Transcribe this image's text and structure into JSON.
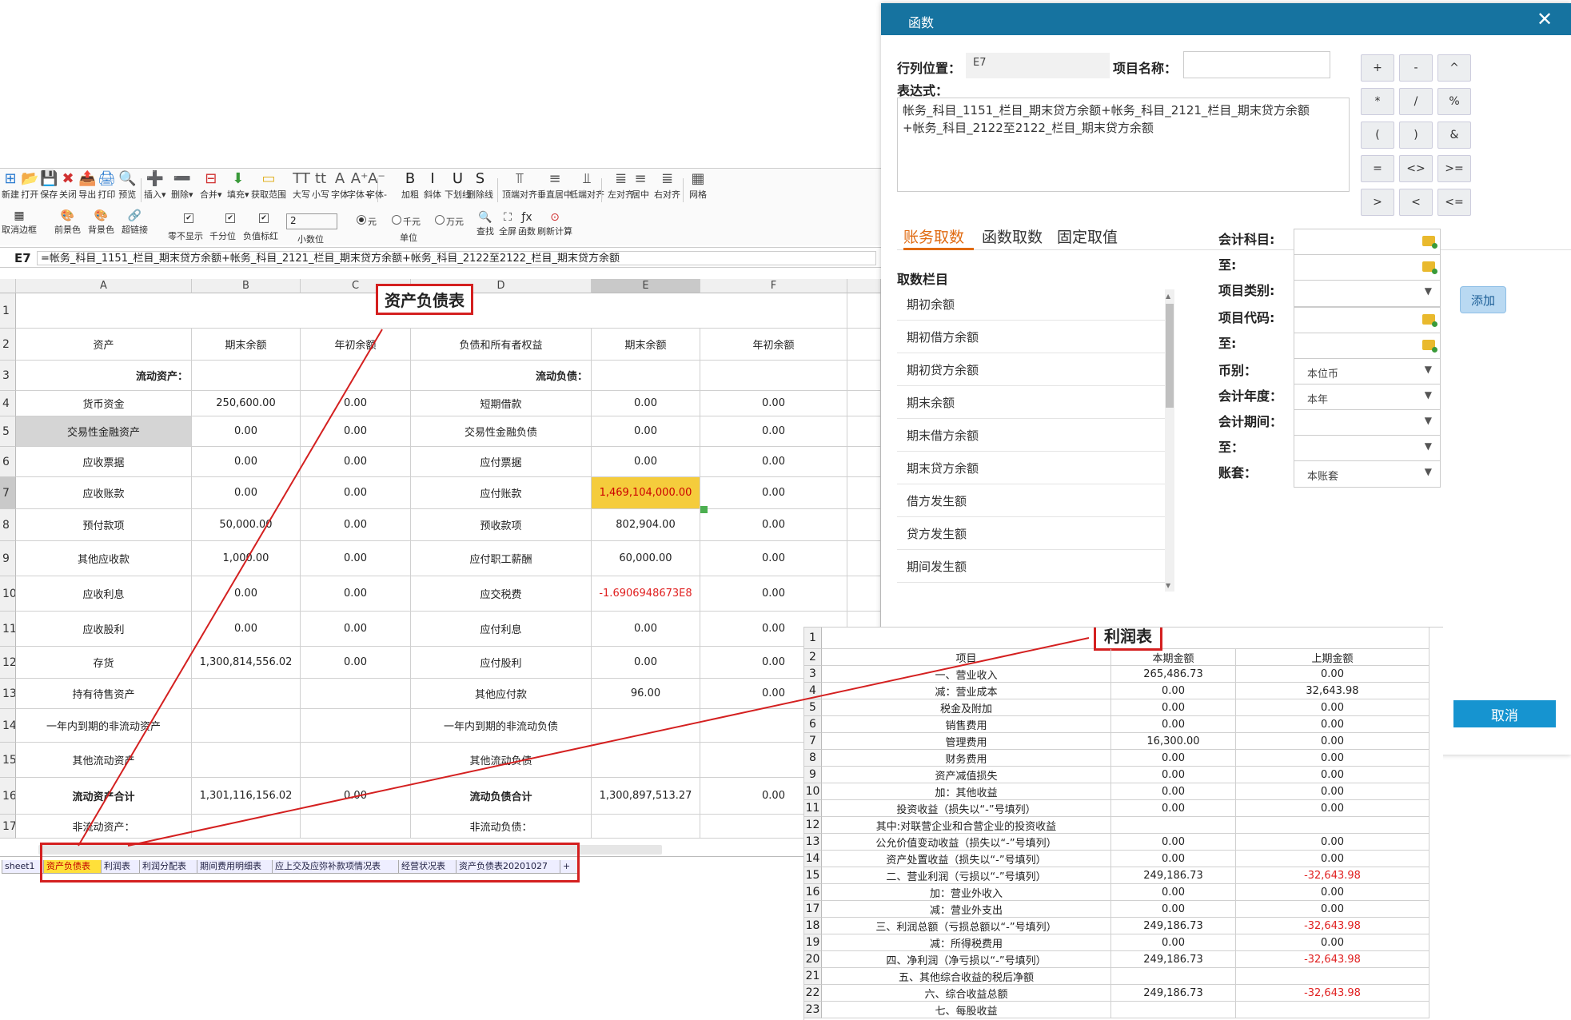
{
  "toolbar": {
    "row1": [
      "新建",
      "打开",
      "保存",
      "关闭",
      "导出",
      "打印",
      "预览",
      "插入▾",
      "删除▾",
      "合并▾",
      "填充▾",
      "获取范围",
      "大写",
      "小写",
      "字体",
      "字体+",
      "字体-",
      "加粗",
      "斜体",
      "下划线",
      "删除线",
      "顶端对齐",
      "垂直居中",
      "低端对齐",
      "左对齐",
      "居中",
      "右对齐",
      "网格"
    ],
    "row2": [
      "取消边框",
      "前景色",
      "背景色",
      "超链接"
    ],
    "zero_hide": "零不显示",
    "thousands_sep": "千分位",
    "neg_red": "负值标红",
    "decimals_value": "2",
    "decimals_label": "小数位",
    "units": [
      "元",
      "千元",
      "万元"
    ],
    "unit_label": "单位",
    "search_tools": [
      "查找",
      "全屏",
      "函数",
      "刷新计算"
    ]
  },
  "formula_bar": {
    "cell_ref": "E7",
    "formula": "=帐务_科目_1151_栏目_期末贷方余额+帐务_科目_2121_栏目_期末贷方余额+帐务_科目_2122至2122_栏目_期末贷方余额"
  },
  "sheet": {
    "columns": [
      "A",
      "B",
      "C",
      "D",
      "E",
      "F"
    ],
    "title": "资产负债表",
    "header_row": [
      "资产",
      "期末余额",
      "年初余额",
      "负债和所有者权益",
      "期末余额",
      "年初余额"
    ],
    "rows": [
      {
        "n": "3",
        "cells": [
          "流动资产：",
          "",
          "",
          "流动负债：",
          "",
          ""
        ]
      },
      {
        "n": "4",
        "cells": [
          "货币资金",
          "250,600.00",
          "0.00",
          "短期借款",
          "0.00",
          "0.00"
        ]
      },
      {
        "n": "5",
        "cells": [
          "交易性金融资产",
          "0.00",
          "0.00",
          "交易性金融负债",
          "0.00",
          "0.00"
        ]
      },
      {
        "n": "6",
        "cells": [
          "应收票据",
          "0.00",
          "0.00",
          "应付票据",
          "0.00",
          "0.00"
        ]
      },
      {
        "n": "7",
        "cells": [
          "应收账款",
          "0.00",
          "0.00",
          "应付账款",
          "1,469,104,000.00",
          "0.00"
        ]
      },
      {
        "n": "8",
        "cells": [
          "预付款项",
          "50,000.00",
          "0.00",
          "预收款项",
          "802,904.00",
          "0.00"
        ]
      },
      {
        "n": "9",
        "cells": [
          "其他应收款",
          "1,000.00",
          "0.00",
          "应付职工薪酬",
          "60,000.00",
          "0.00"
        ]
      },
      {
        "n": "10",
        "cells": [
          "应收利息",
          "0.00",
          "0.00",
          "应交税费",
          "-1.6906948673E8",
          "0.00"
        ]
      },
      {
        "n": "11",
        "cells": [
          "应收股利",
          "0.00",
          "0.00",
          "应付利息",
          "0.00",
          "0.00"
        ]
      },
      {
        "n": "12",
        "cells": [
          "存货",
          "1,300,814,556.02",
          "0.00",
          "应付股利",
          "0.00",
          "0.00"
        ]
      },
      {
        "n": "13",
        "cells": [
          "持有待售资产",
          "",
          "",
          "其他应付款",
          "96.00",
          "0.00"
        ]
      },
      {
        "n": "14",
        "cells": [
          "一年内到期的非流动资产",
          "",
          "",
          "一年内到期的非流动负债",
          "",
          ""
        ]
      },
      {
        "n": "15",
        "cells": [
          "其他流动资产",
          "",
          "",
          "其他流动负债",
          "",
          ""
        ]
      },
      {
        "n": "16",
        "cells": [
          "流动资产合计",
          "1,301,116,156.02",
          "0.00",
          "流动负债合计",
          "1,300,897,513.27",
          "0.00"
        ]
      },
      {
        "n": "17",
        "cells": [
          "非流动资产：",
          "",
          "",
          "非流动负债：",
          "",
          ""
        ]
      }
    ],
    "tabs": [
      "sheet1",
      "资产负债表",
      "利润表",
      "利润分配表",
      "期间费用明细表",
      "应上交及应弥补款项情况表",
      "经营状况表",
      "资产负债表20201027",
      "+"
    ]
  },
  "dialog": {
    "title": "函数",
    "close": "✕",
    "pos_label": "行列位置：",
    "pos_value": "E7",
    "name_label": "项目名称：",
    "name_value": "",
    "expr_label": "表达式：",
    "expr_value": "帐务_科目_1151_栏目_期末贷方余额+帐务_科目_2121_栏目_期末贷方余额\n+帐务_科目_2122至2122_栏目_期末贷方余额",
    "operators": [
      "+",
      "-",
      "^",
      "*",
      "/",
      "%",
      "(",
      ")",
      "&",
      "=",
      "<>",
      ">=",
      ">",
      "<",
      "<="
    ],
    "tabs": [
      "账务取数",
      "函数取数",
      "固定取值"
    ],
    "fields_title": "取数栏目",
    "fields": [
      "期初余额",
      "期初借方余额",
      "期初贷方余额",
      "期末余额",
      "期末借方余额",
      "期末贷方余额",
      "借方发生额",
      "贷方发生额",
      "期间发生额"
    ],
    "form": {
      "account": "会计科目:",
      "to1": "至:",
      "item_type": "项目类别:",
      "item_code": "项目代码:",
      "to2": "至:",
      "currency": "币别：",
      "currency_value": "本位币",
      "year": "会计年度：",
      "year_value": "本年",
      "period": "会计期间：",
      "to3": "至：",
      "book": "账套：",
      "book_value": "本账套"
    },
    "add": "添加",
    "cancel": "取消"
  },
  "profit": {
    "title": "利润表",
    "header": [
      "项目",
      "本期金额",
      "上期金额"
    ],
    "rows": [
      {
        "n": "3",
        "cells": [
          "一、营业收入",
          "265,486.73",
          "0.00"
        ]
      },
      {
        "n": "4",
        "cells": [
          "减：营业成本",
          "0.00",
          "32,643.98"
        ]
      },
      {
        "n": "5",
        "cells": [
          "税金及附加",
          "0.00",
          "0.00"
        ]
      },
      {
        "n": "6",
        "cells": [
          "销售费用",
          "0.00",
          "0.00"
        ]
      },
      {
        "n": "7",
        "cells": [
          "管理费用",
          "16,300.00",
          "0.00"
        ]
      },
      {
        "n": "8",
        "cells": [
          "财务费用",
          "0.00",
          "0.00"
        ]
      },
      {
        "n": "9",
        "cells": [
          "资产减值损失",
          "0.00",
          "0.00"
        ]
      },
      {
        "n": "10",
        "cells": [
          "加：其他收益",
          "0.00",
          "0.00"
        ]
      },
      {
        "n": "11",
        "cells": [
          "投资收益（损失以“-”号填列）",
          "0.00",
          "0.00"
        ]
      },
      {
        "n": "12",
        "cells": [
          "其中:对联营企业和合营企业的投资收益",
          "",
          ""
        ]
      },
      {
        "n": "13",
        "cells": [
          "公允价值变动收益（损失以“-”号填列）",
          "0.00",
          "0.00"
        ]
      },
      {
        "n": "14",
        "cells": [
          "资产处置收益（损失以“-”号填列）",
          "0.00",
          "0.00"
        ]
      },
      {
        "n": "15",
        "cells": [
          "二、营业利润（亏损以“-”号填列）",
          "249,186.73",
          "-32,643.98"
        ]
      },
      {
        "n": "16",
        "cells": [
          "加：营业外收入",
          "0.00",
          "0.00"
        ]
      },
      {
        "n": "17",
        "cells": [
          "减：营业外支出",
          "0.00",
          "0.00"
        ]
      },
      {
        "n": "18",
        "cells": [
          "三、利润总额（亏损总额以“-”号填列）",
          "249,186.73",
          "-32,643.98"
        ]
      },
      {
        "n": "19",
        "cells": [
          "减：所得税费用",
          "0.00",
          "0.00"
        ]
      },
      {
        "n": "20",
        "cells": [
          "四、净利润（净亏损以“-”号填列）",
          "249,186.73",
          "-32,643.98"
        ]
      },
      {
        "n": "21",
        "cells": [
          "五、其他综合收益的税后净额",
          "",
          ""
        ]
      },
      {
        "n": "22",
        "cells": [
          "六、综合收益总额",
          "249,186.73",
          "-32,643.98"
        ]
      },
      {
        "n": "23",
        "cells": [
          "七、每股收益",
          "",
          ""
        ]
      }
    ]
  }
}
